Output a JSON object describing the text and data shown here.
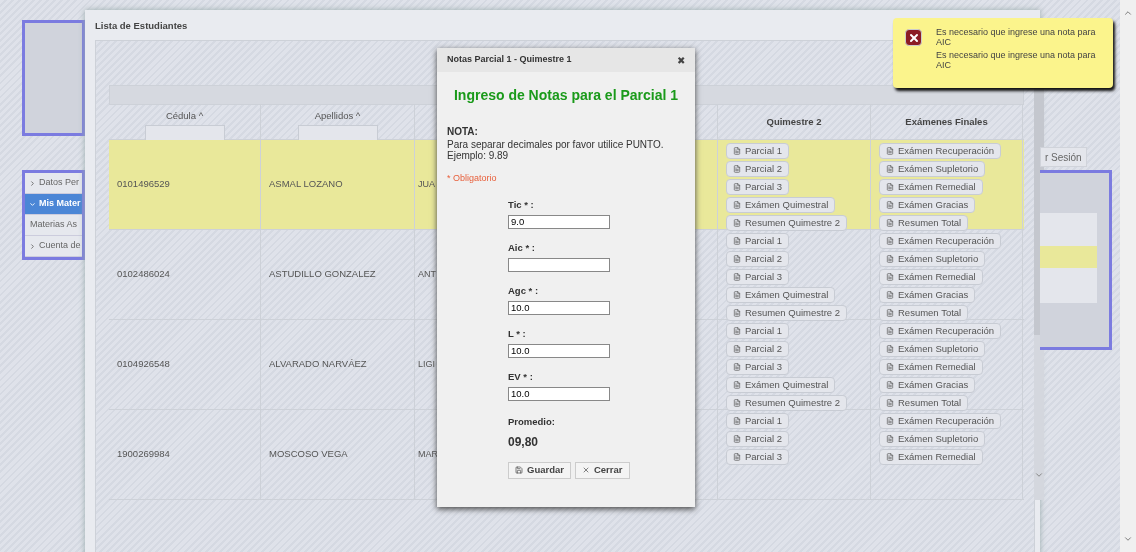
{
  "sidebar": {
    "items": [
      {
        "label": "Datos Per",
        "kind": "section",
        "selected": false,
        "expanded": false
      },
      {
        "label": "Mis Mater",
        "kind": "section",
        "selected": true,
        "expanded": true
      },
      {
        "label": "Materias As",
        "kind": "link",
        "selected": false
      },
      {
        "label": "Cuenta de",
        "kind": "section",
        "selected": false,
        "expanded": false
      }
    ]
  },
  "logout_button": "r Sesión",
  "panel": {
    "title": "Lista de Estudiantes"
  },
  "table": {
    "columns": [
      {
        "label": "Cédula ^",
        "filter": true
      },
      {
        "label": "Apellidos ^",
        "filter": true
      },
      {
        "label": "Quimestre 2",
        "filter": false
      },
      {
        "label": "Exámenes Finales",
        "filter": false
      }
    ],
    "rows": [
      {
        "cedula": "0101496529",
        "apellidos": "ASMAL LOZANO",
        "column_3": "JUA",
        "selected": true,
        "quimestre_2": [
          "Parcial 1",
          "Parcial 2",
          "Parcial 3",
          "Exámen Quimestral",
          "Resumen Quimestre 2"
        ],
        "examenes_finales": [
          "Exámen Recuperación",
          "Exámen Supletorio",
          "Exámen Remedial",
          "Exámen Gracias",
          "Resumen Total"
        ]
      },
      {
        "cedula": "0102486024",
        "apellidos": "ASTUDILLO GONZALEZ",
        "column_3": "ANT",
        "selected": false,
        "quimestre_2": [
          "Parcial 1",
          "Parcial 2",
          "Parcial 3",
          "Exámen Quimestral",
          "Resumen Quimestre 2"
        ],
        "examenes_finales": [
          "Exámen Recuperación",
          "Exámen Supletorio",
          "Exámen Remedial",
          "Exámen Gracias",
          "Resumen Total"
        ]
      },
      {
        "cedula": "0104926548",
        "apellidos": "ALVARADO NARVÁEZ",
        "column_3": "LIGI",
        "selected": false,
        "quimestre_2": [
          "Parcial 1",
          "Parcial 2",
          "Parcial 3",
          "Exámen Quimestral",
          "Resumen Quimestre 2"
        ],
        "examenes_finales": [
          "Exámen Recuperación",
          "Exámen Supletorio",
          "Exámen Remedial",
          "Exámen Gracias",
          "Resumen Total"
        ]
      },
      {
        "cedula": "1900269984",
        "apellidos": "MOSCOSO VEGA",
        "column_3": "MAR",
        "selected": false,
        "quimestre_2": [
          "Parcial 1",
          "Parcial 2",
          "Parcial 3"
        ],
        "examenes_finales": [
          "Exámen Recuperación",
          "Exámen Supletorio",
          "Exámen Remedial"
        ]
      }
    ]
  },
  "dialog": {
    "title": "Notas Parcial 1 - Quimestre 1",
    "close": "✖",
    "heading": "Ingreso de Notas para el Parcial 1",
    "note_label": "NOTA:",
    "note_text": "Para separar decimales por favor utilice PUNTO. Ejemplo: 9.89",
    "required_note": "* Obligatorio",
    "fields": [
      {
        "label": "Tic * :",
        "value": "9.0"
      },
      {
        "label": "Aic * :"
      },
      {
        "label": "Agc * :",
        "value": "10.0"
      },
      {
        "label": "L * :",
        "value": "10.0"
      },
      {
        "label": "EV * :",
        "value": "10.0"
      }
    ],
    "average_label": "Promedio:",
    "average": "09,80",
    "buttons": [
      {
        "label": "Guardar",
        "kind": "save"
      },
      {
        "label": "Cerrar",
        "kind": "close"
      }
    ]
  },
  "notification": {
    "kind": "error",
    "title": "Es necesario que ingrese una nota para AIC",
    "message": "Es necesario que ingrese una nota para AIC"
  }
}
